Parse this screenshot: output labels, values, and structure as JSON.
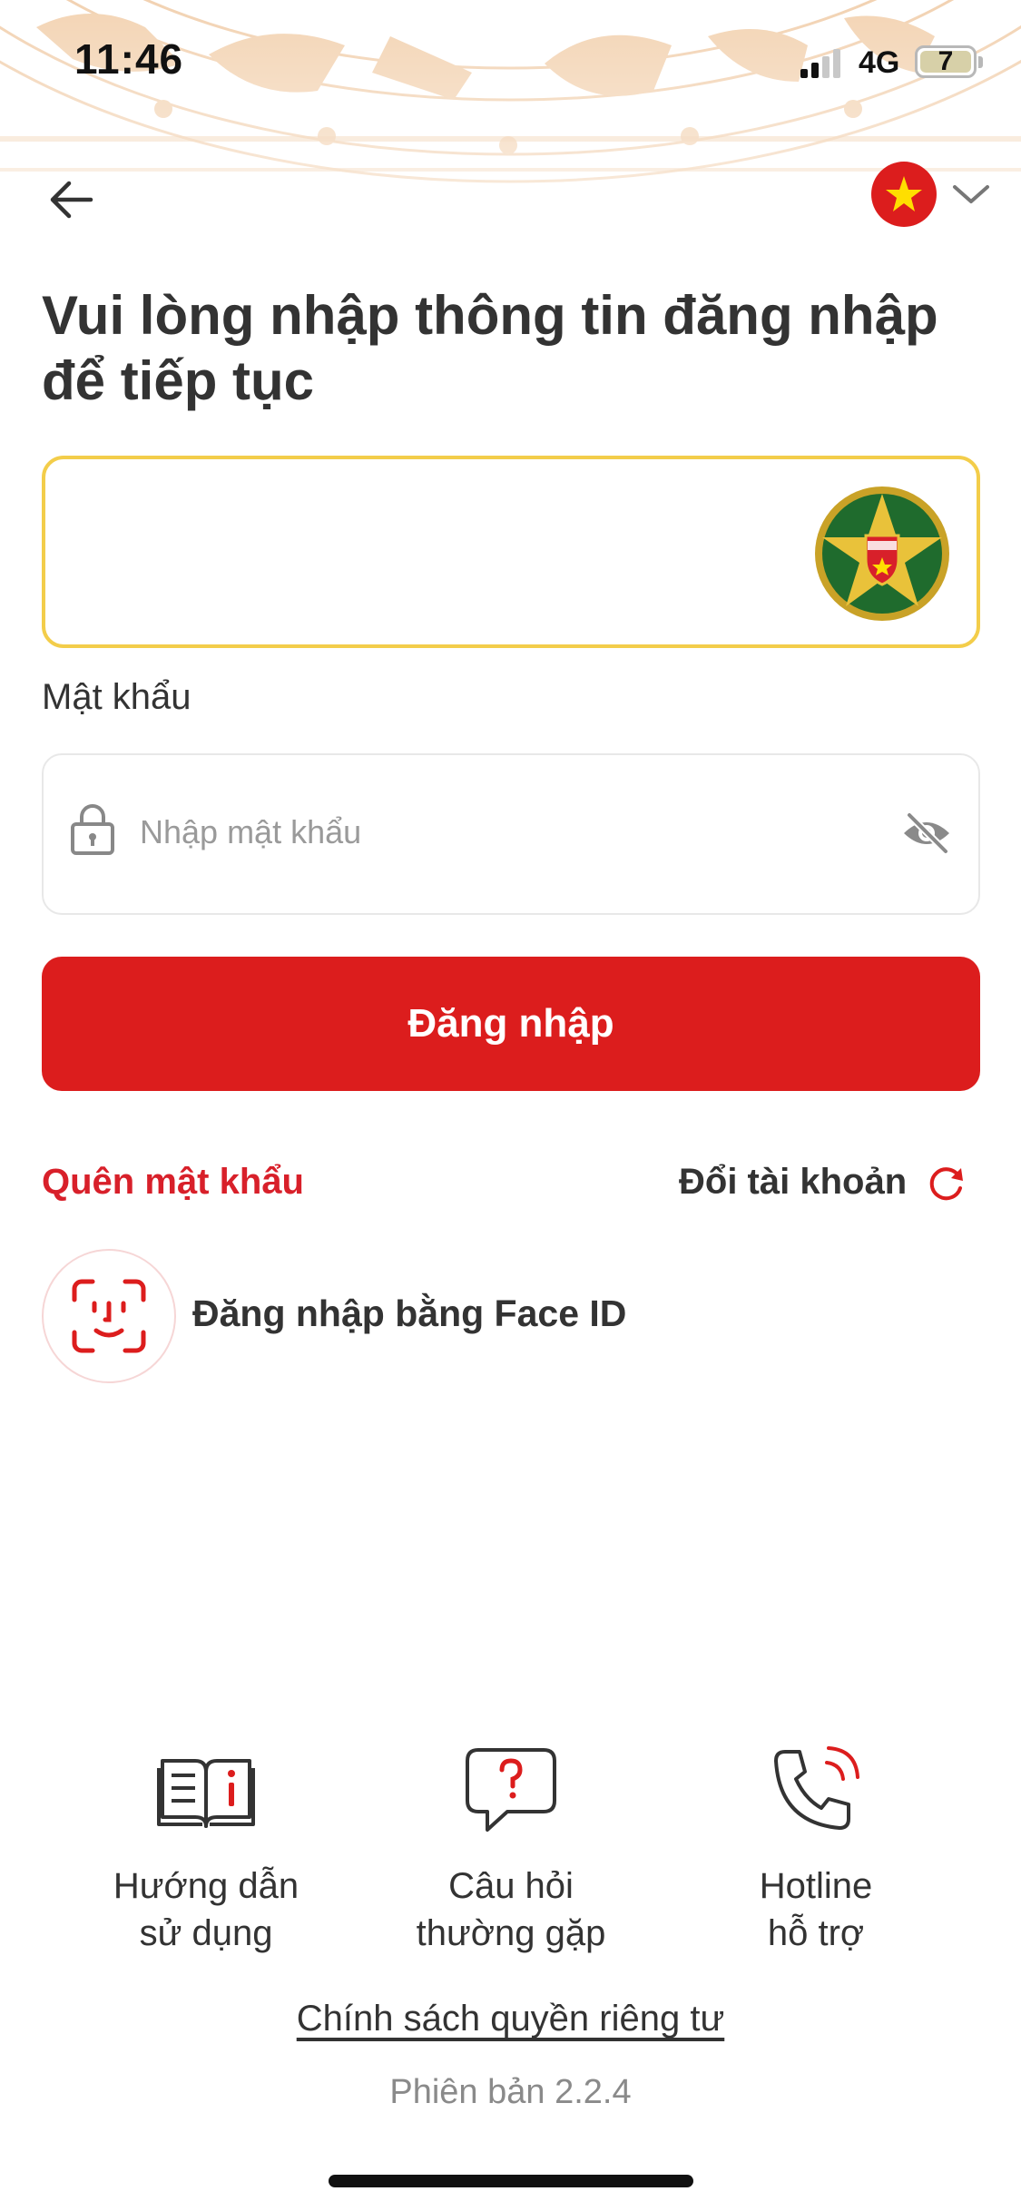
{
  "status_bar": {
    "time": "11:46",
    "network": "4G",
    "battery": "7",
    "battery_level": 0.07
  },
  "header": {
    "back_icon": "arrow-left-icon",
    "language_flag": "vietnam-flag-icon",
    "language_dropdown_icon": "chevron-down-icon"
  },
  "title": {
    "line1": "Vui lòng nhập thông tin đăng nhập",
    "line2": "để tiếp tục"
  },
  "username": {
    "value": "",
    "emblem": "vneid-emblem"
  },
  "password": {
    "label": "Mật khẩu",
    "placeholder": "Nhập mật khẩu",
    "value": "",
    "lock_icon": "lock-icon",
    "visibility_icon": "eye-off-icon"
  },
  "actions": {
    "login_label": "Đăng nhập",
    "forgot_password": "Quên mật khẩu",
    "switch_account": "Đổi tài khoản",
    "face_id_login": "Đăng nhập bằng Face ID"
  },
  "help": {
    "items": [
      {
        "line1": "Hướng dẫn",
        "line2": "sử dụng",
        "icon": "book-info-icon"
      },
      {
        "line1": "Câu hỏi",
        "line2": "thường gặp",
        "icon": "question-bubble-icon"
      },
      {
        "line1": "Hotline",
        "line2": "hỗ trợ",
        "icon": "phone-ring-icon"
      }
    ]
  },
  "footer": {
    "privacy_policy": "Chính sách quyền riêng tư",
    "version": "Phiên bản 2.2.4"
  },
  "colors": {
    "primary_red": "#dc1d1d",
    "link_red": "#d8202a",
    "focus_border": "#f3cd4a",
    "pattern": "#f0c9a2"
  }
}
